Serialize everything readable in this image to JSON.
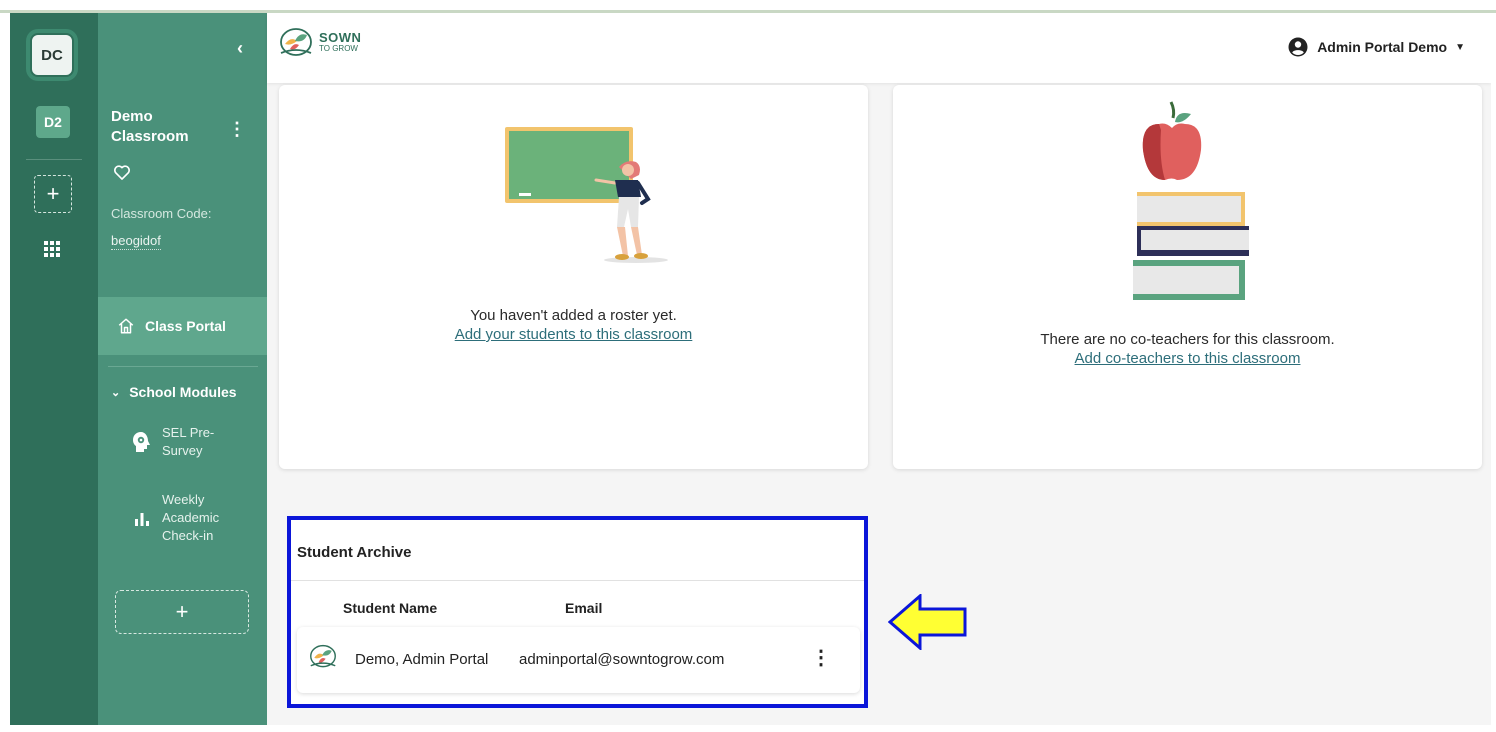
{
  "app": {
    "logo_line1": "SOWN",
    "logo_line2": "TO GROW",
    "user_name": "Admin Portal Demo"
  },
  "rail": {
    "current_badge": "DC",
    "other_badge": "D2"
  },
  "sidebar": {
    "class_title": "Demo Classroom",
    "code_label": "Classroom Code:",
    "code_value": "beogidof",
    "nav_class_portal": "Class Portal",
    "modules_label": "School Modules",
    "modules": [
      {
        "label": "SEL Pre-Survey",
        "icon": "head-gear-icon"
      },
      {
        "label": "Weekly Academic Check-in",
        "icon": "bar-chart-icon"
      }
    ]
  },
  "roster_card": {
    "message": "You haven't added a roster yet.",
    "link": "Add your students to this classroom"
  },
  "coteacher_card": {
    "message": "There are no co-teachers for this classroom.",
    "link": "Add co-teachers to this classroom"
  },
  "archive": {
    "title": "Student Archive",
    "columns": [
      "Student Name",
      "Email"
    ],
    "rows": [
      {
        "name": "Demo, Admin Portal",
        "email": "adminportal@sowntogrow.com"
      }
    ]
  },
  "colors": {
    "rail": "#2f6f5a",
    "sidebar": "#4a917a",
    "highlight_box": "#0b16d9",
    "arrow_fill": "#ffff33"
  }
}
